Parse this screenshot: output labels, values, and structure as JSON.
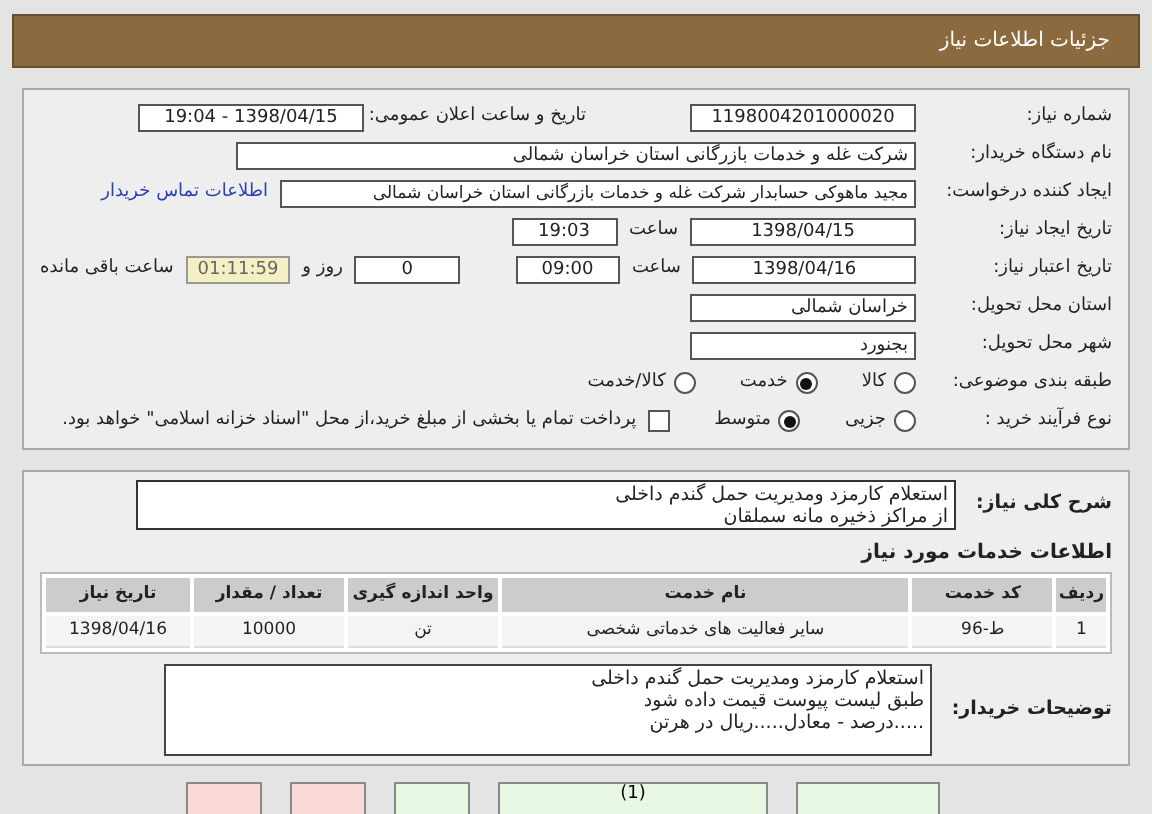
{
  "header": {
    "title": "جزئیات اطلاعات نیاز"
  },
  "need": {
    "number_label": "شماره نیاز:",
    "number": "1198004201000020",
    "announce_label": "تاریخ و ساعت اعلان عمومی:",
    "announce": "1398/04/15 - 19:04",
    "buyer_label": "نام دستگاه خریدار:",
    "buyer": "شرکت غله و خدمات بازرگانی استان خراسان شمالی",
    "creator_label": "ایجاد کننده درخواست:",
    "creator": "مجید ماهوکی حسابدار شرکت غله و خدمات بازرگانی استان خراسان شمالی",
    "contact_link": "اطلاعات تماس خریدار",
    "created_label": "تاریخ ایجاد نیاز:",
    "created_date": "1398/04/15",
    "created_time_label": "ساعت",
    "created_time": "19:03",
    "valid_label": "تاریخ اعتبار نیاز:",
    "valid_date": "1398/04/16",
    "valid_time_label": "ساعت",
    "valid_time": "09:00",
    "days": "0",
    "days_label": "روز و",
    "remaining": "01:11:59",
    "remaining_label": "ساعت باقی مانده",
    "province_label": "استان محل تحویل:",
    "province": "خراسان شمالی",
    "city_label": "شهر محل تحویل:",
    "city": "بجنورد",
    "category_label": "طبقه بندی موضوعی:",
    "categories": [
      {
        "label": "کالا",
        "selected": false
      },
      {
        "label": "خدمت",
        "selected": true
      },
      {
        "label": "کالا/خدمت",
        "selected": false
      }
    ],
    "process_label": "نوع فرآیند خرید :",
    "processes": [
      {
        "label": "جزیی",
        "selected": false
      },
      {
        "label": "متوسط",
        "selected": true
      }
    ],
    "treasury": {
      "label": "پرداخت تمام یا بخشی از مبلغ خرید،از محل \"اسناد خزانه اسلامی\" خواهد بود.",
      "checked": false
    }
  },
  "details": {
    "summary_label": "شرح کلی نیاز:",
    "summary": [
      "استعلام کارمزد ومدیریت حمل گندم داخلی",
      "از مراکز ذخیره مانه سملقان"
    ],
    "services_title": "اطلاعات خدمات مورد نیاز",
    "table": {
      "columns": [
        "ردیف",
        "کد خدمت",
        "نام خدمت",
        "واحد اندازه گیری",
        "تعداد / مقدار",
        "تاریخ نیاز"
      ],
      "rows": [
        [
          "1",
          "ط-96",
          "سایر فعالیت های خدماتی شخصی",
          "تن",
          "10000",
          "1398/04/16"
        ]
      ]
    },
    "notes_label": "توضیحات خریدار:",
    "notes": [
      "استعلام کارمزد ومدیریت حمل گندم داخلی",
      "طبق لیست پیوست قیمت داده شود",
      ".....درصد   - معادل.....ریال در هرتن"
    ]
  },
  "buttons": [
    {
      "color": "#e8f7e4"
    },
    {
      "label": "(1)",
      "color": "#e8f7e4"
    },
    {
      "color": "#e8f7e4"
    },
    {
      "color": "#fbd9d9"
    },
    {
      "color": "#fbd9d9"
    }
  ]
}
